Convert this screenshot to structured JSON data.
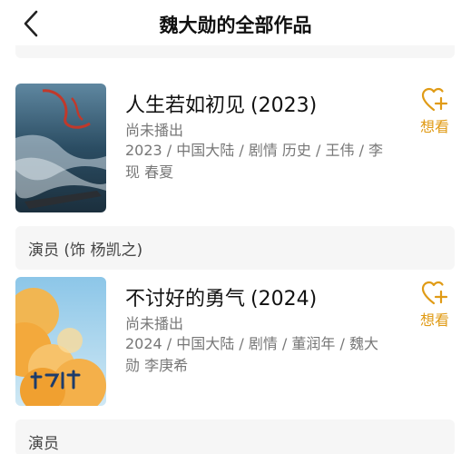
{
  "header": {
    "title": "魏大勋的全部作品"
  },
  "sections": [
    {
      "role_label": "",
      "item": {
        "title": "人生若如初见",
        "year": "(2023)",
        "status": "尚未播出",
        "meta": "2023 / 中国大陆 / 剧情 历史 / 王伟 / 李现 春夏",
        "want_label": "想看"
      }
    },
    {
      "role_label": "演员 (饰 杨凯之)",
      "item": {
        "title": "不讨好的勇气",
        "year": "(2024)",
        "status": "尚未播出",
        "meta": "2024 / 中国大陆 / 剧情 / 董润年 / 魏大勋 李庚希",
        "want_label": "想看"
      }
    },
    {
      "role_label": "演员"
    }
  ],
  "colors": {
    "accent": "#e09b16",
    "section_bg": "#f6f6f6"
  }
}
